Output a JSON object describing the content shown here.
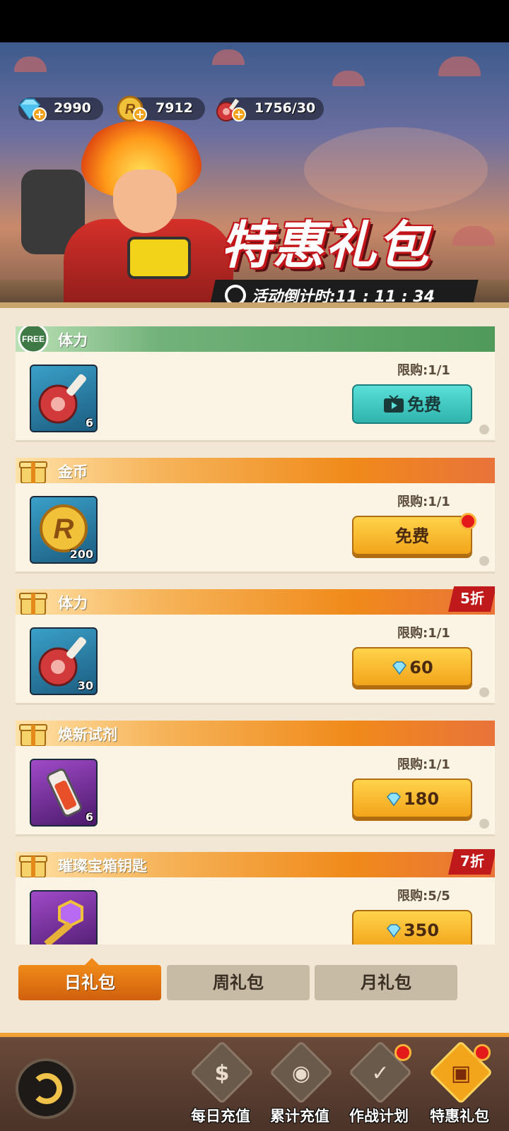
{
  "resources": {
    "gems": "2990",
    "coins": "7912",
    "stamina": "1756/30"
  },
  "banner": {
    "title": "特惠礼包",
    "countdown_label": "活动倒计时:",
    "countdown_value": "11 : 11 : 34"
  },
  "packs": [
    {
      "header": "体力",
      "header_style": "free",
      "qty": "6",
      "limit": "限购:1/1",
      "button": "免费",
      "button_style": "ad",
      "discount": ""
    },
    {
      "header": "金币",
      "header_style": "gift",
      "qty": "200",
      "limit": "限购:1/1",
      "button": "免费",
      "button_style": "gold",
      "discount": ""
    },
    {
      "header": "体力",
      "header_style": "gift",
      "qty": "30",
      "limit": "限购:1/1",
      "button": "60",
      "button_style": "gold-gem",
      "discount": "5折"
    },
    {
      "header": "焕新试剂",
      "header_style": "gift",
      "qty": "6",
      "limit": "限购:1/1",
      "button": "180",
      "button_style": "gold-gem",
      "discount": ""
    },
    {
      "header": "璀璨宝箱钥匙",
      "header_style": "gift",
      "qty": "",
      "limit": "限购:5/5",
      "button": "350",
      "button_style": "gold-gem",
      "discount": "7折"
    }
  ],
  "tabs": [
    "日礼包",
    "周礼包",
    "月礼包"
  ],
  "nav": [
    "每日充值",
    "累计充值",
    "作战计划",
    "特惠礼包"
  ],
  "colors": {
    "accent": "#f2a41a",
    "teal": "#2fb3ad",
    "free_header": "#4f9a5a",
    "gift_header": "#f08a1a",
    "discount": "#c0191b"
  }
}
